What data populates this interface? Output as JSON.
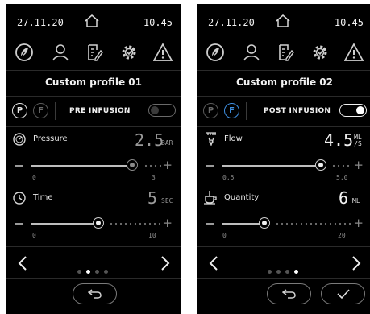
{
  "panels": [
    {
      "status": {
        "date": "27.11.20",
        "time": "10.45"
      },
      "title": "Custom profile 01",
      "modes": [
        "P",
        "F"
      ],
      "phase_label": "PRE INFUSION",
      "toggle_on": false,
      "param1": {
        "label": "Pressure",
        "value": "2.5",
        "unit": "BAR",
        "min": "0",
        "max": "3",
        "level": 0.83
      },
      "param2": {
        "label": "Time",
        "value": "5",
        "unit": "SEC",
        "min": "0",
        "max": "10",
        "level": 0.5
      },
      "page_dots": 4,
      "active_page": 1,
      "buttons": [
        "back"
      ]
    },
    {
      "status": {
        "date": "27.11.20",
        "time": "10.45"
      },
      "title": "Custom profile 02",
      "modes": [
        "P",
        "F"
      ],
      "phase_label": "POST INFUSION",
      "toggle_on": true,
      "param1": {
        "label": "Flow",
        "value": "4.5",
        "unit_top": "ML",
        "unit_bottom": "/S",
        "min": "0.5",
        "max": "5.0",
        "level": 0.89
      },
      "param2": {
        "label": "Quantity",
        "value": "6",
        "unit": "ML",
        "min": "0",
        "max": "20",
        "level": 0.3
      },
      "page_dots": 4,
      "active_page": 3,
      "buttons": [
        "back",
        "confirm"
      ]
    }
  ],
  "icons": [
    "leaf-icon",
    "user-icon",
    "notes-icon",
    "settings-icon",
    "warning-icon",
    "home-icon",
    "pressure-gauge-icon",
    "timer-icon",
    "shower-icon",
    "cup-icon",
    "back-arrow-icon",
    "chevron-left-icon",
    "chevron-right-icon",
    "undo-icon",
    "check-icon"
  ],
  "colors": {
    "background": "#000000",
    "accent_blue": "#3f8fe0",
    "text": "#f2f2f2",
    "dim": "#6a6a6a"
  }
}
